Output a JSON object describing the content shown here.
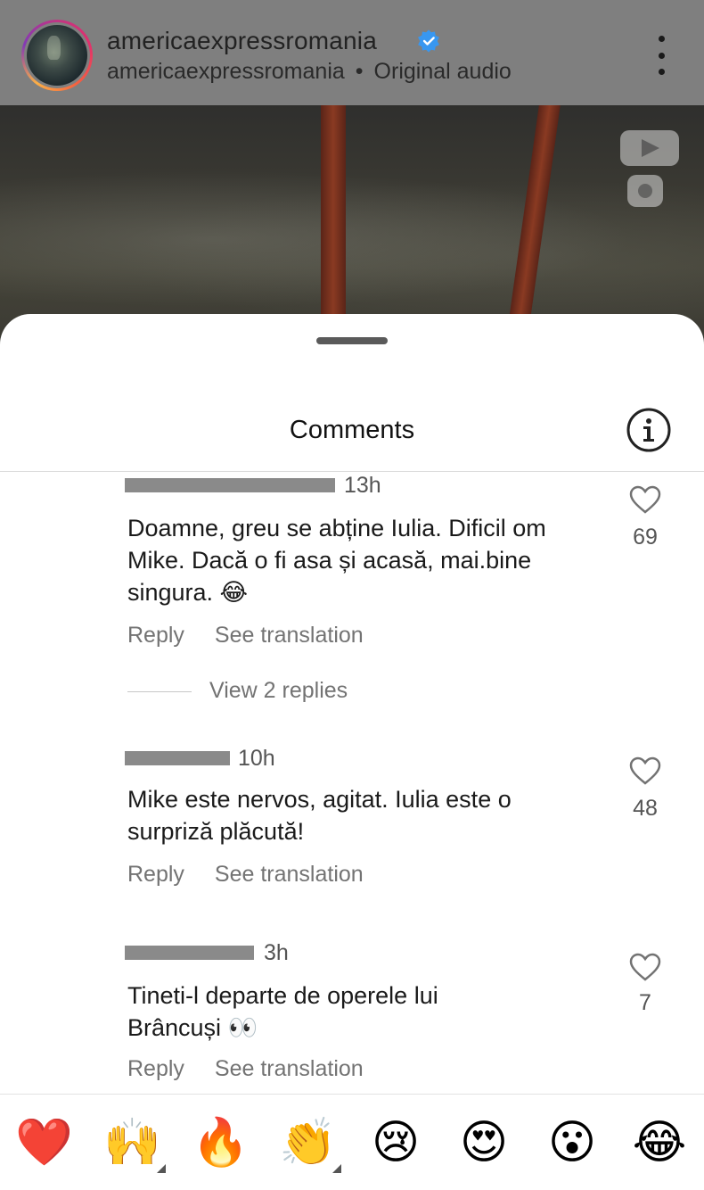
{
  "header": {
    "account_name": "americaexpressromania",
    "sub_account": "americaexpressromania",
    "separator": "•",
    "audio_label": "Original audio"
  },
  "sheet": {
    "title": "Comments"
  },
  "comments": [
    {
      "time": "13h",
      "text": "Doamne, greu se abține Iulia.  Dificil om Mike. Dacă o fi asa și acasă, mai.bine singura. 😂",
      "reply_label": "Reply",
      "translate_label": "See translation",
      "likes": "69",
      "view_replies": "View 2 replies"
    },
    {
      "time": "10h",
      "text": "Mike este nervos, agitat. Iulia este o surpriză plăcută!",
      "reply_label": "Reply",
      "translate_label": "See translation",
      "likes": "48"
    },
    {
      "time": "3h",
      "text": "Tineti-l departe de operele lui Brâncuși 👀",
      "reply_label": "Reply",
      "translate_label": "See translation",
      "likes": "7"
    }
  ],
  "emoji_bar": [
    {
      "icon": "red-heart",
      "glyph": "❤️"
    },
    {
      "icon": "raising-hands",
      "glyph": "🙌"
    },
    {
      "icon": "fire",
      "glyph": "🔥"
    },
    {
      "icon": "clapping-hands",
      "glyph": "👏"
    },
    {
      "icon": "crying-face",
      "glyph": "😢"
    },
    {
      "icon": "heart-eyes",
      "glyph": "😍"
    },
    {
      "icon": "surprised-face",
      "glyph": "😮"
    },
    {
      "icon": "tears-of-joy",
      "glyph": "😂"
    }
  ],
  "colors": {
    "verified": "#3897f0",
    "secondary_text": "#737373",
    "header_bg": "#7f7f7f"
  }
}
